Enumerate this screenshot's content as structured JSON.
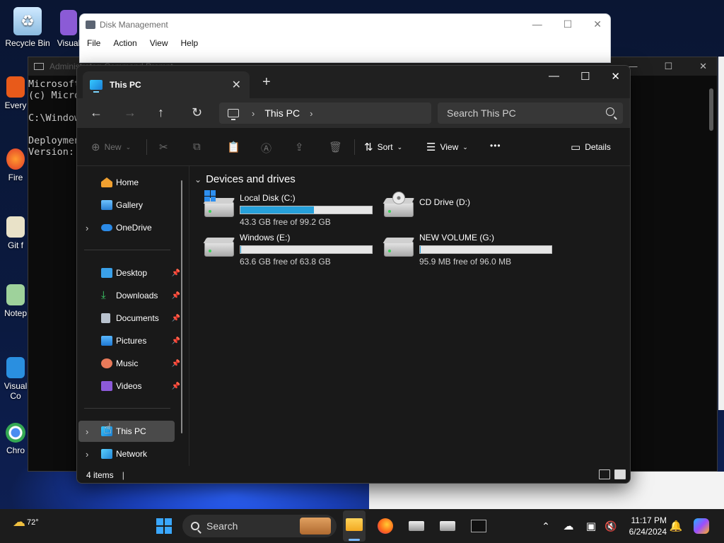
{
  "desktop": {
    "icons": [
      {
        "label": "Recycle Bin"
      },
      {
        "label": "Visual"
      },
      {
        "label": "Every"
      },
      {
        "label": "Fire"
      },
      {
        "label": "Git f"
      },
      {
        "label": "Notep"
      },
      {
        "label": "Visual Co"
      },
      {
        "label": "Chro"
      }
    ]
  },
  "disk_management": {
    "title": "Disk Management",
    "menu": [
      "File",
      "Action",
      "View",
      "Help"
    ]
  },
  "cmd": {
    "title": "Administrator: Command Prompt",
    "lines": [
      "Microsoft",
      "(c) Micro",
      "",
      "C:\\Window",
      "",
      "Deploymen",
      "Version: "
    ]
  },
  "explorer": {
    "tab_title": "This PC",
    "new_tab": "+",
    "address": {
      "crumbs": [
        "This PC"
      ]
    },
    "search_placeholder": "Search This PC",
    "commands": {
      "new": "New",
      "sort": "Sort",
      "view": "View",
      "more": "•••",
      "details": "Details"
    },
    "nav": {
      "home": "Home",
      "gallery": "Gallery",
      "onedrive": "OneDrive",
      "desktop": "Desktop",
      "downloads": "Downloads",
      "documents": "Documents",
      "pictures": "Pictures",
      "music": "Music",
      "videos": "Videos",
      "this_pc": "This PC",
      "network": "Network"
    },
    "section_title": "Devices and drives",
    "drives": [
      {
        "name": "Local Disk (C:)",
        "free": "43.3 GB free of 99.2 GB",
        "used_fraction": 0.56
      },
      {
        "name": "CD Drive (D:)",
        "free": "",
        "used_fraction": null
      },
      {
        "name": "Windows (E:)",
        "free": "63.6 GB free of 63.8 GB",
        "used_fraction": 0.003
      },
      {
        "name": "NEW VOLUME (G:)",
        "free": "95.9 MB free of 96.0 MB",
        "used_fraction": 0.001
      }
    ],
    "status": "4 items"
  },
  "taskbar": {
    "weather_temp": "72°",
    "search_label": "Search",
    "time": "11:17 PM",
    "date": "6/24/2024"
  }
}
